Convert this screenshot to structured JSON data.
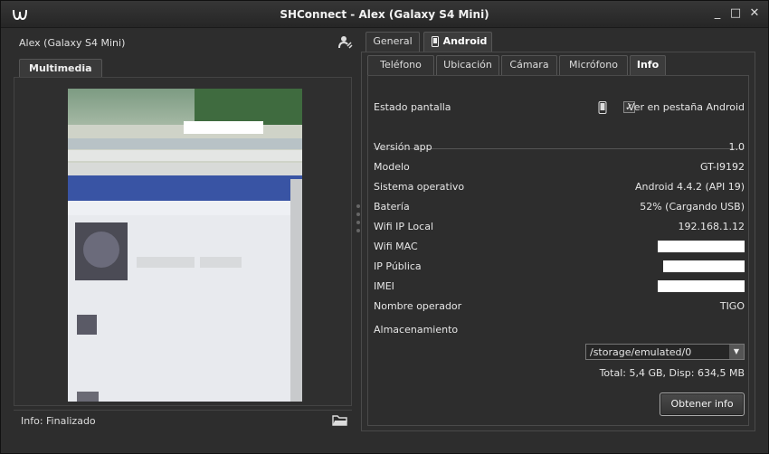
{
  "window": {
    "title": "SHConnect - Alex (Galaxy S4 Mini)",
    "minimize": "_",
    "maximize": "□",
    "close": "✕"
  },
  "left": {
    "device_name": "Alex (Galaxy S4 Mini)",
    "tab": "Multimedia",
    "status": "Info: Finalizado",
    "icons": {
      "device": "device-settings-icon",
      "folder": "folder-open-icon"
    }
  },
  "tabs": {
    "top": [
      "General",
      "Android"
    ],
    "top_active": "Android",
    "sub": [
      "Teléfono",
      "Ubicación",
      "Cámara",
      "Micrófono",
      "Info"
    ],
    "sub_active": "Info"
  },
  "info": {
    "screen_state_label": "Estado pantalla",
    "view_tab_label": "Ver en pestaña Android",
    "view_tab_checked": true,
    "rows": [
      {
        "label": "Versión app",
        "value": "1.0"
      },
      {
        "label": "Modelo",
        "value": "GT-I9192"
      },
      {
        "label": "Sistema operativo",
        "value": "Android 4.4.2 (API 19)"
      },
      {
        "label": "Batería",
        "value": "52% (Cargando USB)"
      },
      {
        "label": "Wifi IP Local",
        "value": "192.168.1.12"
      },
      {
        "label": "Wifi MAC",
        "value": ""
      },
      {
        "label": "IP Pública",
        "value": ""
      },
      {
        "label": "IMEI",
        "value": ""
      },
      {
        "label": "Nombre operador",
        "value": "TIGO"
      }
    ],
    "storage_label": "Almacenamiento",
    "storage_value": "/storage/emulated/0",
    "storage_summary": "Total: 5,4 GB, Disp: 634,5 MB",
    "button": "Obtener info"
  },
  "colors": {
    "background": "#2d2d2d",
    "text": "#e6e6e6",
    "border": "#4a4a4a"
  }
}
